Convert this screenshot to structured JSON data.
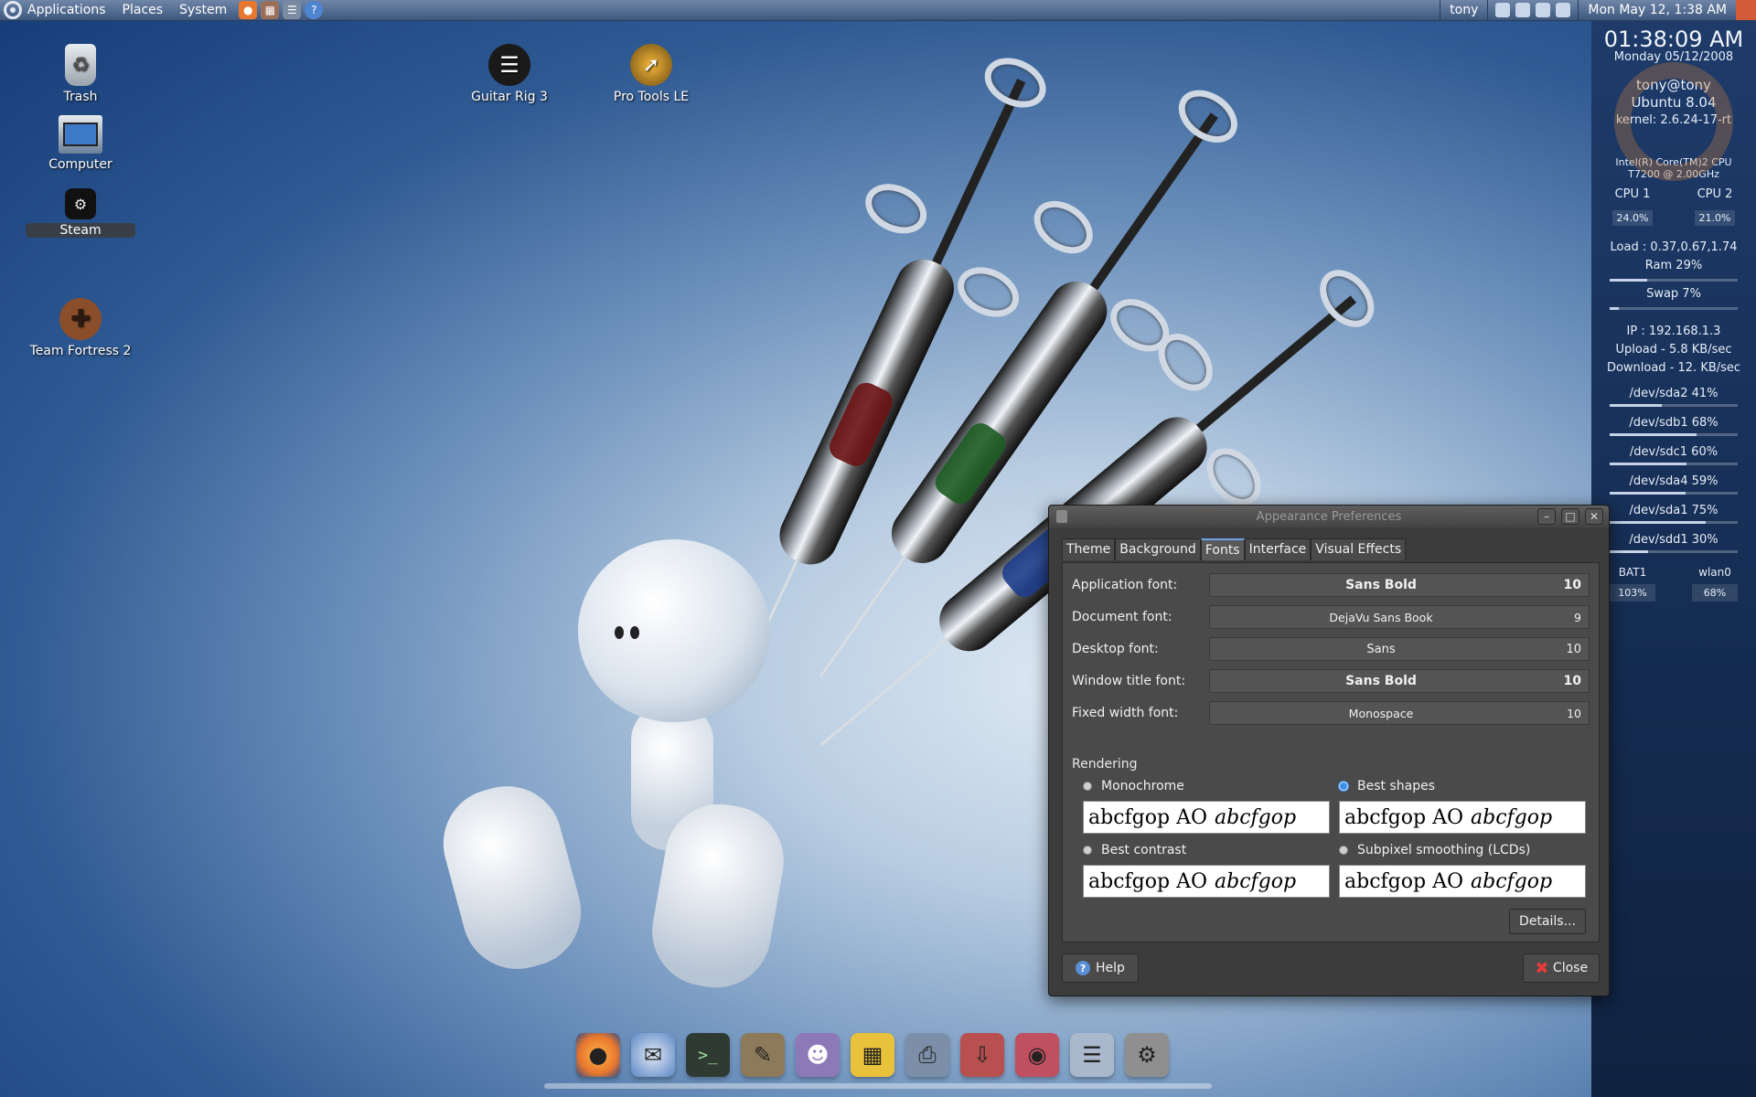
{
  "top_panel": {
    "menus": [
      "Applications",
      "Places",
      "System"
    ],
    "launchers": [
      {
        "icon": "firefox-icon",
        "color": "#e8772e"
      },
      {
        "icon": "mixer-icon",
        "color": "#9a6f5a"
      },
      {
        "icon": "network-icon",
        "color": "#7a8aa0"
      },
      {
        "icon": "help-icon",
        "color": "#4f85d0"
      }
    ],
    "user": "tony",
    "clock": "Mon May 12,  1:38 AM"
  },
  "conky": {
    "time": "01:38:09 AM",
    "date": "Monday 05/12/2008",
    "user_host": "tony@tony",
    "os": "Ubuntu 8.04",
    "kernel": "kernel: 2.6.24-17-rt",
    "cpu_name_1": "Intel(R) Core(TM)2 CPU",
    "cpu_name_2": "T7200  @ 2.00GHz",
    "cpu1_label": "CPU 1",
    "cpu2_label": "CPU 2",
    "cpu1_value": "24.0%",
    "cpu2_value": "21.0%",
    "load": "Load : 0.37,0.67,1.74",
    "ram": "Ram 29%",
    "ram_level": 0.29,
    "swap": "Swap 7%",
    "swap_level": 0.07,
    "ip": "IP : 192.168.1.3",
    "upload": "Upload - 5.8 KB/sec",
    "download": "Download - 12. KB/sec",
    "disks": [
      {
        "label": "/dev/sda2 41%",
        "level": 0.41
      },
      {
        "label": "/dev/sdb1 68%",
        "level": 0.68
      },
      {
        "label": "/dev/sdc1 60%",
        "level": 0.6
      },
      {
        "label": "/dev/sda4 59%",
        "level": 0.59
      },
      {
        "label": "/dev/sda1 75%",
        "level": 0.75
      },
      {
        "label": "/dev/sdd1 30%",
        "level": 0.3
      }
    ],
    "bat_label": "BAT1",
    "bat_value": "103%",
    "wlan_label": "wlan0",
    "wlan_value": "68%"
  },
  "desktop_icons": [
    {
      "label": "Trash",
      "icon": "trash-icon"
    },
    {
      "label": "Computer",
      "icon": "computer-icon"
    },
    {
      "label": "Steam",
      "icon": "steam-icon"
    },
    {
      "label": "Team Fortress 2",
      "icon": "tf2-icon"
    },
    {
      "label": "Guitar Rig 3",
      "icon": "guitar-rig-icon"
    },
    {
      "label": "Pro Tools LE",
      "icon": "pro-tools-icon"
    }
  ],
  "dialog": {
    "title": "Appearance Preferences",
    "tabs": [
      "Theme",
      "Background",
      "Fonts",
      "Interface",
      "Visual Effects"
    ],
    "active_tab": "Fonts",
    "fonts": [
      {
        "label": "Application font:",
        "name": "Sans Bold",
        "size": "10"
      },
      {
        "label": "Document font:",
        "name": "DejaVu Sans Book",
        "size": "9"
      },
      {
        "label": "Desktop font:",
        "name": "Sans",
        "size": "10"
      },
      {
        "label": "Window title font:",
        "name": "Sans Bold",
        "size": "10"
      },
      {
        "label": "Fixed width font:",
        "name": "Monospace",
        "size": "10"
      }
    ],
    "rendering_title": "Rendering",
    "rendering": [
      {
        "label": "Monochrome",
        "selected": false
      },
      {
        "label": "Best shapes",
        "selected": true
      },
      {
        "label": "Best contrast",
        "selected": false
      },
      {
        "label": "Subpixel smoothing (LCDs)",
        "selected": false
      }
    ],
    "sample_regular": "abcfgop AO",
    "sample_italic": "abcfgop",
    "details_button": "Details...",
    "help_button": "Help",
    "close_button": "Close"
  },
  "dock": [
    {
      "icon": "firefox-icon",
      "color": "#e8772e"
    },
    {
      "icon": "thunderbird-icon",
      "color": "#5b86c4"
    },
    {
      "icon": "terminal-icon",
      "color": "#2f3a33"
    },
    {
      "icon": "gimp-icon",
      "color": "#8c7a5a"
    },
    {
      "icon": "pidgin-icon",
      "color": "#8e79b8"
    },
    {
      "icon": "archive-icon",
      "color": "#e8c23a"
    },
    {
      "icon": "scanner-icon",
      "color": "#7d8ea8"
    },
    {
      "icon": "installer-icon",
      "color": "#b85050"
    },
    {
      "icon": "disc-burner-icon",
      "color": "#c05060"
    },
    {
      "icon": "mixer-icon",
      "color": "#a9b8cc"
    },
    {
      "icon": "system-tools-icon",
      "color": "#8f8f8f"
    }
  ]
}
